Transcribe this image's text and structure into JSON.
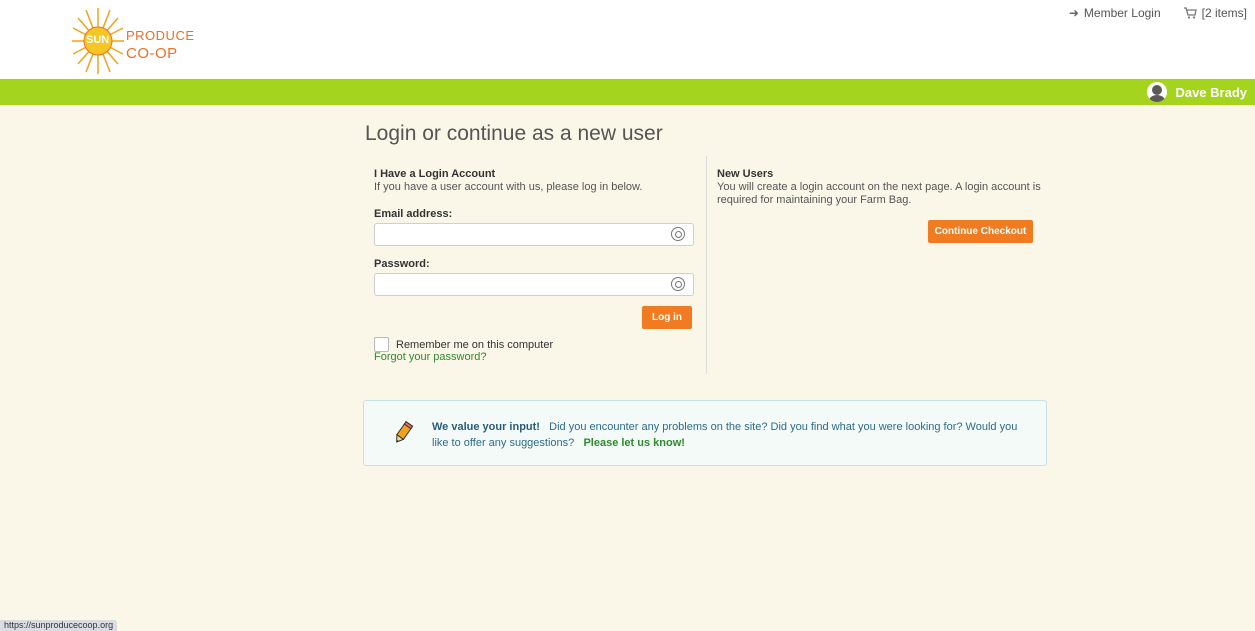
{
  "header": {
    "logo_word1": "PRODUCE",
    "logo_word2": "CO-OP",
    "logo_badge": "SUN",
    "member_login": "Member Login",
    "cart": "[2 items]",
    "user_name": "Dave Brady"
  },
  "page": {
    "title": "Login or continue as a new user"
  },
  "login": {
    "heading": "I Have a Login Account",
    "subtext": "If you have a user account with us, please log in below.",
    "email_label": "Email address:",
    "email_value": "",
    "password_label": "Password:",
    "password_value": "",
    "login_button": "Log in",
    "remember_label": "Remember me on this computer",
    "forgot_link": "Forgot your password?"
  },
  "new_users": {
    "heading": "New Users",
    "text": "You will create a login account on the next page. A login account is required for maintaining your Farm Bag.",
    "continue_button": "Continue Checkout"
  },
  "feedback": {
    "strong": "We value your input!",
    "text": "Did you encounter any problems on the site? Did you find what you were looking for? Would you like to offer any suggestions?",
    "link": "Please let us know!"
  },
  "status_url": "https://sunproducecoop.org",
  "colors": {
    "brand_green": "#a4d41e",
    "accent_orange": "#f07b21",
    "link_green": "#2f8a2f",
    "page_bg": "#faf6e8"
  },
  "icons": {
    "member_login": "sign-in-icon",
    "cart": "cart-icon",
    "user": "user-avatar-icon",
    "password_manager": "key-icon",
    "feedback": "pencil-icon"
  }
}
